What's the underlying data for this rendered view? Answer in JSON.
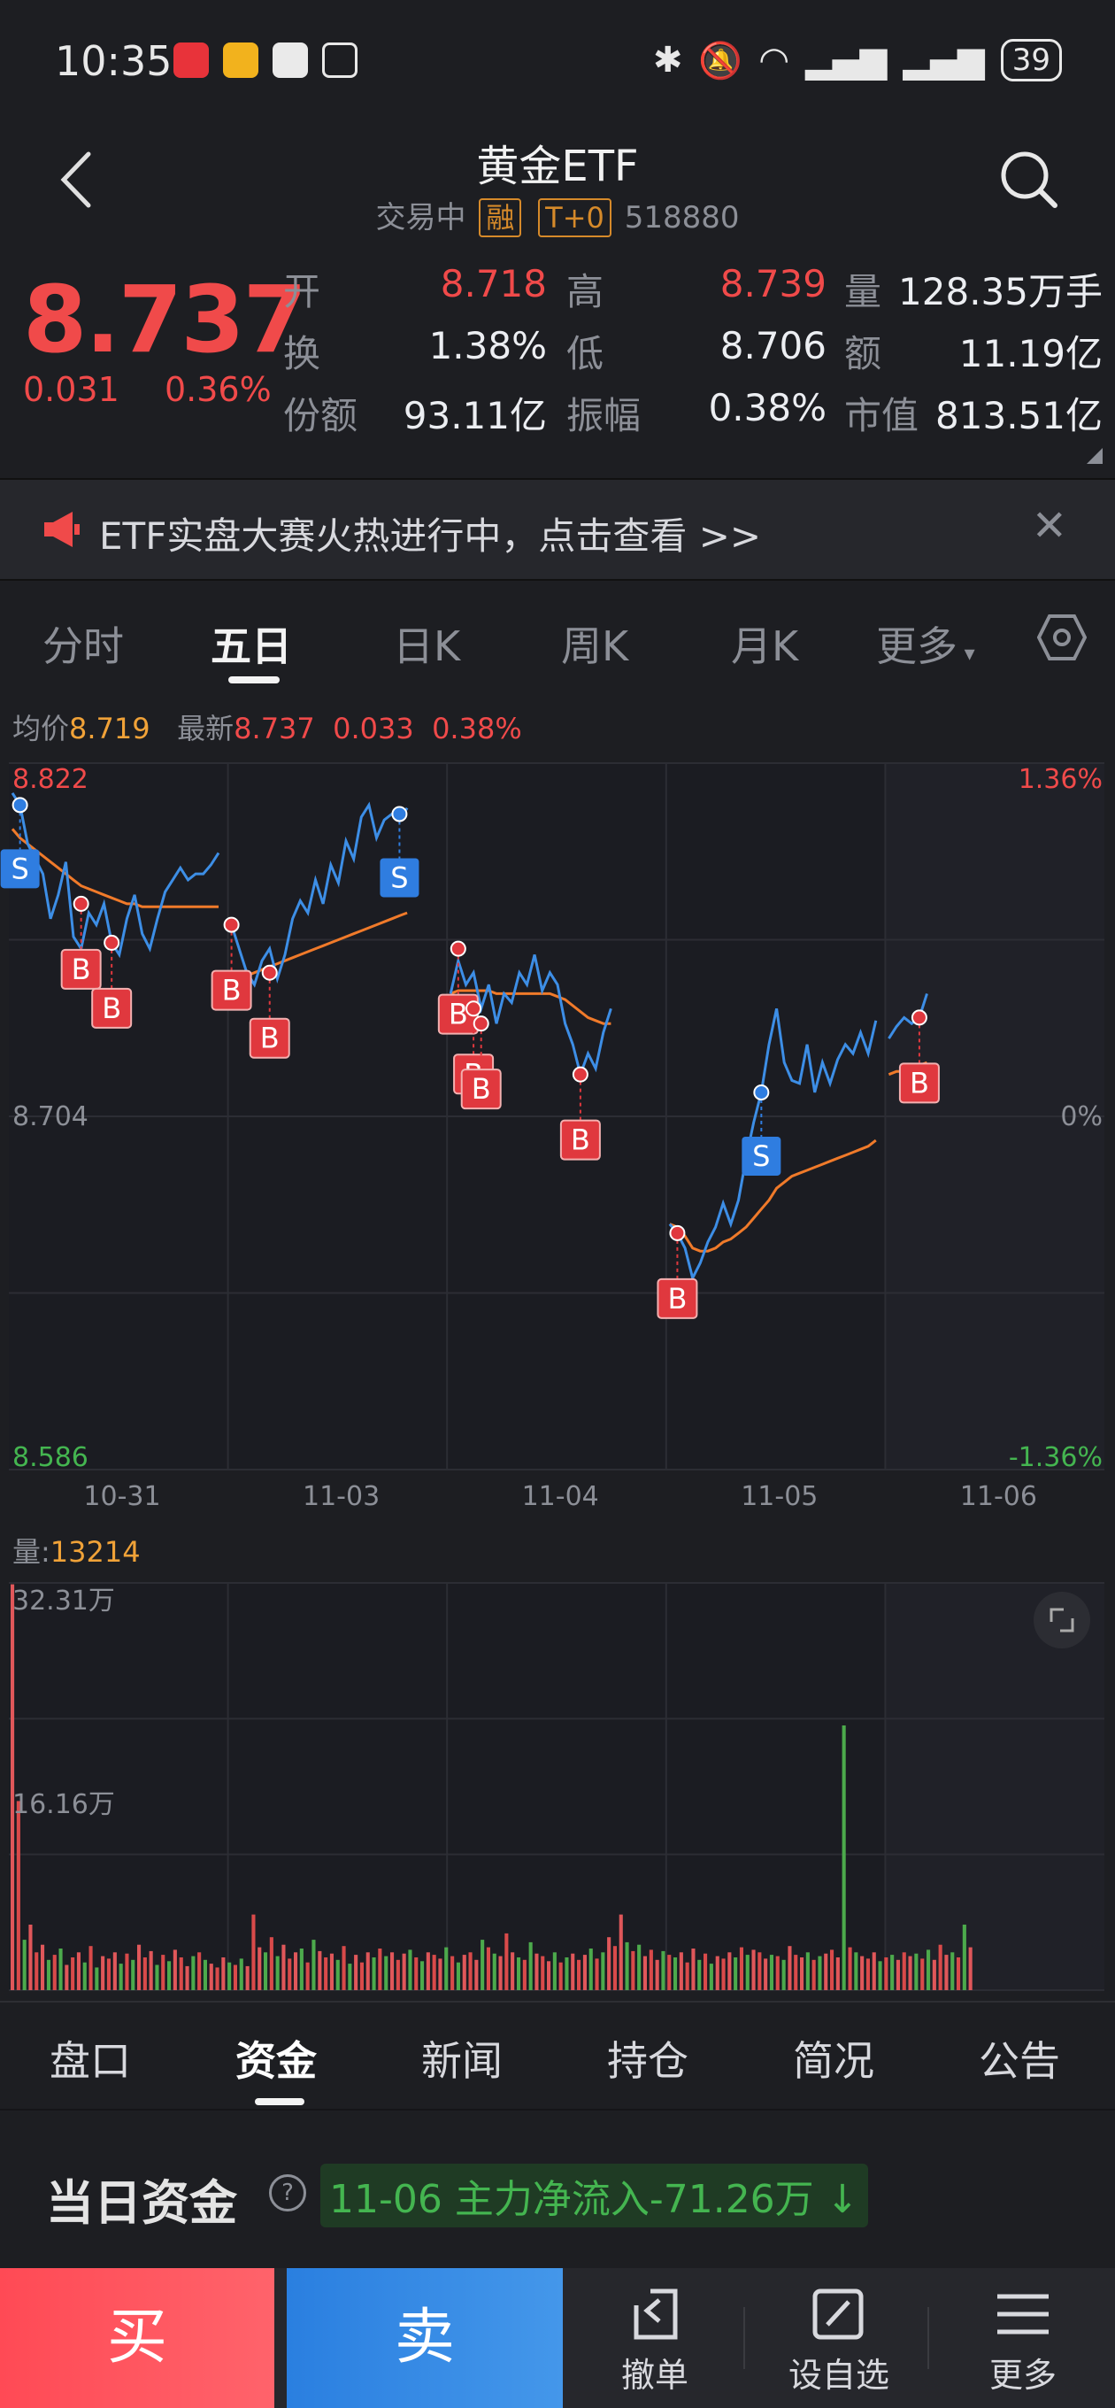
{
  "status_bar": {
    "time": "10:35",
    "battery": "39"
  },
  "header": {
    "title": "黄金ETF",
    "status": "交易中",
    "tag_margin": "融",
    "tag_t0": "T+0",
    "code": "518880"
  },
  "quote": {
    "price": "8.737",
    "change": "0.031",
    "change_pct": "0.36%",
    "fields": [
      {
        "label": "开",
        "value": "8.718",
        "color": "#f04a4a"
      },
      {
        "label": "高",
        "value": "8.739",
        "color": "#f04a4a"
      },
      {
        "label": "量",
        "value": "128.35万手",
        "color": "#eceef2"
      },
      {
        "label": "换",
        "value": "1.38%",
        "color": "#eceef2"
      },
      {
        "label": "低",
        "value": "8.706",
        "color": "#eceef2"
      },
      {
        "label": "额",
        "value": "11.19亿",
        "color": "#eceef2"
      },
      {
        "label": "份额",
        "value": "93.11亿",
        "color": "#eceef2"
      },
      {
        "label": "振幅",
        "value": "0.38%",
        "color": "#eceef2"
      },
      {
        "label": "市值",
        "value": "813.51亿",
        "color": "#eceef2"
      }
    ]
  },
  "banner": {
    "text": "ETF实盘大赛火热进行中，点击查看 >>"
  },
  "tabs": [
    "分时",
    "五日",
    "日K",
    "周K",
    "月K",
    "更多"
  ],
  "active_tab": "五日",
  "chart_info": {
    "avg_label": "均价",
    "avg_value": "8.719",
    "latest_label": "最新",
    "latest_value": "8.737",
    "latest_change": "0.033",
    "latest_pct": "0.38%"
  },
  "chart_data": {
    "type": "line",
    "x_labels": [
      "10-31",
      "11-03",
      "11-04",
      "11-05",
      "11-06"
    ],
    "ylim": [
      8.586,
      8.822
    ],
    "y_labels_left": [
      "8.822",
      "8.704",
      "8.586"
    ],
    "y_labels_right": [
      "1.36%",
      "0%",
      "-1.36%"
    ],
    "colors": {
      "price": "#3d8ee6",
      "avg": "#f07a2a"
    },
    "series": [
      {
        "day": "10-31",
        "price": [
          8.812,
          8.808,
          8.795,
          8.79,
          8.785,
          8.77,
          8.778,
          8.789,
          8.764,
          8.76,
          8.772,
          8.768,
          8.775,
          8.762,
          8.758,
          8.77,
          8.778,
          8.765,
          8.76,
          8.77,
          8.779,
          8.783,
          8.787,
          8.783,
          8.785,
          8.785,
          8.788,
          8.792
        ],
        "avg": [
          8.8,
          8.797,
          8.795,
          8.793,
          8.791,
          8.789,
          8.787,
          8.785,
          8.783,
          8.781,
          8.78,
          8.779,
          8.778,
          8.777,
          8.776,
          8.775,
          8.775,
          8.774,
          8.774,
          8.774,
          8.774,
          8.774,
          8.774,
          8.774,
          8.774,
          8.774,
          8.774,
          8.774
        ]
      },
      {
        "day": "11-03",
        "price": [
          8.768,
          8.76,
          8.752,
          8.748,
          8.756,
          8.76,
          8.75,
          8.758,
          8.77,
          8.776,
          8.772,
          8.783,
          8.775,
          8.788,
          8.782,
          8.796,
          8.79,
          8.804,
          8.808,
          8.797,
          8.803,
          8.805,
          8.803,
          8.807
        ],
        "avg": [
          8.752,
          8.752,
          8.751,
          8.752,
          8.753,
          8.754,
          8.755,
          8.756,
          8.757,
          8.758,
          8.759,
          8.76,
          8.761,
          8.762,
          8.763,
          8.764,
          8.765,
          8.766,
          8.767,
          8.768,
          8.769,
          8.77,
          8.771,
          8.772
        ]
      },
      {
        "day": "11-04",
        "price": [
          8.745,
          8.756,
          8.748,
          8.752,
          8.74,
          8.748,
          8.735,
          8.745,
          8.742,
          8.752,
          8.748,
          8.758,
          8.746,
          8.752,
          8.748,
          8.735,
          8.728,
          8.718,
          8.725,
          8.72,
          8.732,
          8.74
        ],
        "avg": [
          8.745,
          8.746,
          8.746,
          8.746,
          8.746,
          8.746,
          8.745,
          8.745,
          8.745,
          8.745,
          8.745,
          8.745,
          8.745,
          8.745,
          8.744,
          8.743,
          8.741,
          8.739,
          8.737,
          8.736,
          8.735,
          8.735
        ]
      },
      {
        "day": "11-05",
        "price": [
          8.668,
          8.665,
          8.66,
          8.65,
          8.655,
          8.662,
          8.667,
          8.675,
          8.668,
          8.676,
          8.69,
          8.702,
          8.712,
          8.728,
          8.74,
          8.722,
          8.716,
          8.715,
          8.728,
          8.712,
          8.722,
          8.715,
          8.723,
          8.728,
          8.725,
          8.732,
          8.725,
          8.736
        ],
        "avg": [
          8.668,
          8.667,
          8.664,
          8.66,
          8.659,
          8.659,
          8.66,
          8.662,
          8.663,
          8.665,
          8.667,
          8.67,
          8.673,
          8.676,
          8.68,
          8.682,
          8.684,
          8.685,
          8.686,
          8.687,
          8.688,
          8.689,
          8.69,
          8.691,
          8.692,
          8.693,
          8.694,
          8.696
        ]
      },
      {
        "day": "11-06",
        "price": [
          8.73,
          8.734,
          8.737,
          8.735,
          8.737,
          8.745
        ],
        "avg": [
          8.718,
          8.719,
          8.719,
          8.72,
          8.721,
          8.722
        ]
      }
    ],
    "markers": [
      {
        "type": "S",
        "day": 0,
        "index": 1,
        "price": 8.808
      },
      {
        "type": "B",
        "day": 0,
        "index": 9,
        "price": 8.775
      },
      {
        "type": "B",
        "day": 0,
        "index": 13,
        "price": 8.762
      },
      {
        "type": "B",
        "day": 1,
        "index": 0,
        "price": 8.768
      },
      {
        "type": "B",
        "day": 1,
        "index": 5,
        "price": 8.752
      },
      {
        "type": "S",
        "day": 1,
        "index": 22,
        "price": 8.805
      },
      {
        "type": "B",
        "day": 2,
        "index": 1,
        "price": 8.76
      },
      {
        "type": "B",
        "day": 2,
        "index": 3,
        "price": 8.74
      },
      {
        "type": "B",
        "day": 2,
        "index": 4,
        "price": 8.735
      },
      {
        "type": "B",
        "day": 2,
        "index": 17,
        "price": 8.718
      },
      {
        "type": "B",
        "day": 3,
        "index": 1,
        "price": 8.665
      },
      {
        "type": "S",
        "day": 3,
        "index": 12,
        "price": 8.712
      },
      {
        "type": "B",
        "day": 4,
        "index": 4,
        "price": 8.737
      }
    ]
  },
  "volume": {
    "label": "量",
    "value": "13214",
    "max_label": "32.31万",
    "mid_label": "16.16万",
    "max": 323100,
    "bars": [
      322000,
      150000,
      40000,
      52000,
      30000,
      36000,
      24000,
      28000,
      33000,
      20000,
      26000,
      30000,
      22000,
      35000,
      18000,
      27000,
      25000,
      30000,
      21000,
      29000,
      24000,
      36000,
      26000,
      31000,
      20000,
      28000,
      23000,
      32000,
      26000,
      19000,
      27000,
      30000,
      24000,
      21000,
      18000,
      26000,
      22000,
      20000,
      25000,
      19000,
      60000,
      34000,
      30000,
      42000,
      27000,
      36000,
      25000,
      30000,
      33000,
      22000,
      40000,
      31000,
      26000,
      29000,
      24000,
      35000,
      21000,
      28000,
      22000,
      30000,
      26000,
      33000,
      27000,
      30000,
      24000,
      29000,
      32000,
      26000,
      23000,
      30000,
      28000,
      25000,
      34000,
      27000,
      22000,
      28000,
      30000,
      24000,
      40000,
      34000,
      29000,
      27000,
      45000,
      30000,
      26000,
      24000,
      38000,
      29000,
      27000,
      23000,
      30000,
      22000,
      26000,
      29000,
      24000,
      28000,
      33000,
      25000,
      30000,
      42000,
      35000,
      60000,
      38000,
      31000,
      36000,
      27000,
      32000,
      24000,
      31000,
      28000,
      26000,
      30000,
      22000,
      33000,
      24000,
      29000,
      21000,
      27000,
      25000,
      30000,
      26000,
      34000,
      28000,
      32000,
      30000,
      25000,
      28000,
      27000,
      24000,
      35000,
      28000,
      26000,
      30000,
      24000,
      27000,
      29000,
      32000,
      26000,
      210000,
      34000,
      30000,
      27000,
      25000,
      30000,
      23000,
      26000,
      28000,
      24000,
      30000,
      27000,
      29000,
      25000,
      32000,
      24000,
      36000,
      28000,
      30000,
      26000,
      52000,
      34000
    ],
    "bar_colors_note": "alternating"
  },
  "bottom_tabs": [
    "盘口",
    "资金",
    "新闻",
    "持仓",
    "简况",
    "公告"
  ],
  "active_bottom_tab": "资金",
  "fund": {
    "title": "当日资金",
    "help": "?",
    "flow": "11-06 主力净流入-71.26万"
  },
  "actions": {
    "buy": "买",
    "sell": "卖",
    "cancel_order": "撤单",
    "watchlist": "设自选",
    "more": "更多"
  }
}
